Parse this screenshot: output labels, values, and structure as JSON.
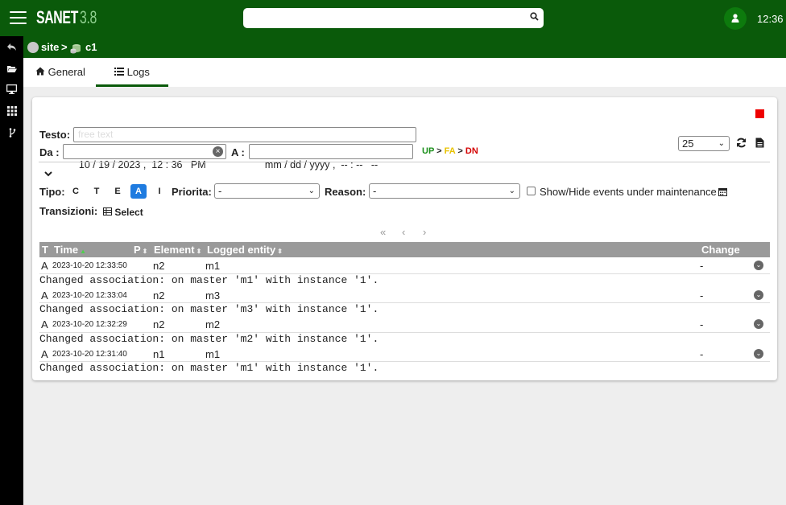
{
  "header": {
    "app_name": "SANET",
    "version": "3.8",
    "search_placeholder": "",
    "clock": "12:36"
  },
  "icons": {
    "menu": "hamburger-icon",
    "search": "search-icon",
    "user": "user-icon",
    "sidebar": [
      "reply-icon",
      "folder-open-icon",
      "desktop-icon",
      "grid-icon",
      "branch-icon"
    ]
  },
  "breadcrumb": {
    "site": "site",
    "separator": ">",
    "node": "c1"
  },
  "tabs": [
    {
      "label": "General",
      "icon": "home-icon"
    },
    {
      "label": "Logs",
      "icon": "list-icon",
      "active": true
    }
  ],
  "filters": {
    "testo_label": "Testo:",
    "testo_placeholder": "free text",
    "da_label": "Da :",
    "da_value": "10 / 19 / 2023 ,  12 : 36   PM",
    "a_label": "A :",
    "a_value": "mm / dd / yyyy ,  -- : --   --",
    "states": {
      "up": "UP",
      "fa": "FA",
      "dn": "DN",
      "sep": ">"
    },
    "page_size": "25",
    "tipo_label": "Tipo:",
    "tipo_buttons": [
      "C",
      "T",
      "E",
      "A",
      "I"
    ],
    "tipo_active": "A",
    "priorita_label": "Priorita:",
    "priorita_value": "-",
    "reason_label": "Reason:",
    "reason_value": "-",
    "maintenance_label": "Show/Hide events under maintenance",
    "transizioni_label": "Transizioni:",
    "select_label": "Select"
  },
  "pager": {
    "first": "«",
    "prev": "‹",
    "next": "›"
  },
  "table": {
    "columns": {
      "t": "T",
      "time": "Time",
      "p": "P",
      "element": "Element",
      "entity": "Logged entity",
      "change": "Change"
    },
    "rows": [
      {
        "t": "A",
        "time": "2023-10-20 12:33:50",
        "element": "n2",
        "entity": "m1",
        "change": "-",
        "detail": "Changed association: on master 'm1' with instance '1'."
      },
      {
        "t": "A",
        "time": "2023-10-20 12:33:04",
        "element": "n2",
        "entity": "m3",
        "change": "-",
        "detail": "Changed association: on master 'm3' with instance '1'."
      },
      {
        "t": "A",
        "time": "2023-10-20 12:32:29",
        "element": "n2",
        "entity": "m2",
        "change": "-",
        "detail": "Changed association: on master 'm2' with instance '1'."
      },
      {
        "t": "A",
        "time": "2023-10-20 12:31:40",
        "element": "n1",
        "entity": "m1",
        "change": "-",
        "detail": "Changed association: on master 'm1' with instance '1'."
      }
    ]
  },
  "colors": {
    "brand_green": "#0a5a0a",
    "active_blue": "#1e7be0",
    "stop_red": "#e00000"
  }
}
